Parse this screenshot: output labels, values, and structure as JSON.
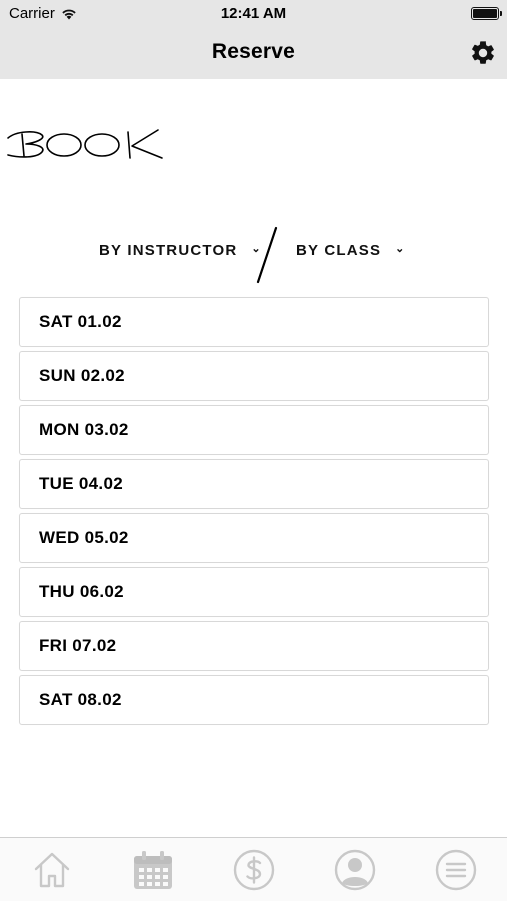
{
  "status_bar": {
    "carrier": "Carrier",
    "time": "12:41 AM",
    "wifi_icon": "wifi-icon",
    "battery_icon": "battery-icon"
  },
  "nav": {
    "title": "Reserve",
    "settings_icon": "gear-icon"
  },
  "header": {
    "logo_text": "BOOK"
  },
  "filters": {
    "instructor_label": "BY INSTRUCTOR",
    "class_label": "BY CLASS",
    "chevron": "⌄"
  },
  "dates": [
    "SAT 01.02",
    "SUN 02.02",
    "MON 03.02",
    "TUE 04.02",
    "WED 05.02",
    "THU 06.02",
    "FRI 07.02",
    "SAT 08.02"
  ],
  "tab_bar": {
    "tabs": [
      "home-icon",
      "calendar-icon",
      "dollar-icon",
      "profile-icon",
      "menu-icon"
    ]
  },
  "colors": {
    "bar_background": "#e6e6e6",
    "icon_gray": "#c8c8c8",
    "border": "#d8d8d8"
  }
}
